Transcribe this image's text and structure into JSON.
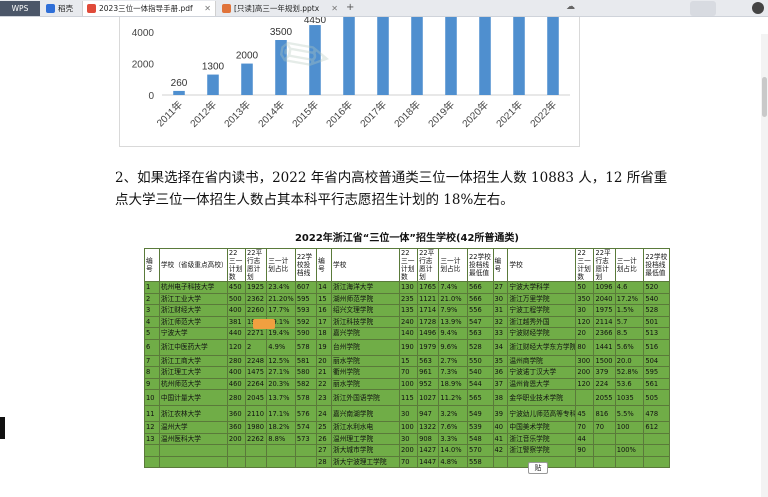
{
  "tabs": {
    "wps": "WPS",
    "home": "稻壳",
    "pdf": "2023三位一体指导手册.pdf",
    "pptx": "[只读]高三一年规划.pptx"
  },
  "chart_data": {
    "type": "bar",
    "categories": [
      "2011年",
      "2012年",
      "2013年",
      "2014年",
      "2015年",
      "2016年",
      "2017年",
      "2018年",
      "2019年",
      "2020年",
      "2021年",
      "2022年"
    ],
    "values": [
      260,
      1300,
      2000,
      3500,
      4450,
      null,
      null,
      null,
      null,
      null,
      null,
      null
    ],
    "data_labels": [
      "260",
      "1300",
      "2000",
      "3500",
      "4450"
    ],
    "yticks": [
      "0",
      "2000",
      "4000"
    ],
    "ylim": [
      0,
      5600
    ],
    "bar_color": "#4f8fcf"
  },
  "paragraph": "2、如果选择在省内读书，2022 年省内高校普通类三位一体招生人数 10883 人，12 所省重点大学三位一体招生人数占其本科平行志愿招生计划的 18%左右。",
  "table": {
    "title": "2022年浙江省“三位一体”招生学校(42所普通类)",
    "headers": [
      "编号",
      "学校（省级重点高校）",
      "22三一计划数",
      "22平行志愿计划",
      "三一计划占比",
      "22学校投档线",
      "编号",
      "学校",
      "22三一计划数",
      "22平行志愿计划",
      "三一计划占比",
      "22学校投档线最低值",
      "编号",
      "学校",
      "22三一计划数",
      "22平行志愿计划",
      "三一计划占比",
      "22学校投档线最低值"
    ],
    "rows": [
      [
        "1",
        "杭州电子科技大学",
        "450",
        "1925",
        "23.4%",
        "607",
        "14",
        "浙江海洋大学",
        "130",
        "1765",
        "7.4%",
        "566",
        "27",
        "宁波大学科学",
        "50",
        "1096",
        "4.6",
        "520"
      ],
      [
        "2",
        "浙江工业大学",
        "500",
        "2362",
        "21.20%",
        "595",
        "15",
        "湖州师范学院",
        "235",
        "1121",
        "21.0%",
        "566",
        "30",
        "浙江万里学院",
        "350",
        "2040",
        "17.2%",
        "540"
      ],
      [
        "3",
        "浙江财经大学",
        "400",
        "2260",
        "17.7%",
        "593",
        "16",
        "绍兴文理学院",
        "135",
        "1714",
        "7.9%",
        "556",
        "31",
        "宁波工程学院",
        "30",
        "1975",
        "1.5%",
        "528"
      ],
      [
        "4",
        "浙江师范大学",
        "381",
        "1997",
        "19.1%",
        "592",
        "17",
        "浙江科技学院",
        "240",
        "1728",
        "13.9%",
        "547",
        "32",
        "浙江越秀外国",
        "120",
        "2114",
        "5.7",
        "501"
      ],
      [
        "5",
        "宁波大学",
        "440",
        "2271",
        "19.4%",
        "590",
        "18",
        "嘉兴学院",
        "140",
        "1496",
        "9.4%",
        "563",
        "33",
        "宁波财经学院",
        "20",
        "2366",
        "8.5",
        "513"
      ],
      [
        "6",
        "浙江中医药大学",
        "120",
        "2",
        "4.9%",
        "578",
        "19",
        "台州学院",
        "190",
        "1979",
        "9.6%",
        "528",
        "34",
        "浙江财经大学东方学院",
        "80",
        "1441",
        "5.6%",
        "516"
      ],
      [
        "7",
        "浙江工商大学",
        "280",
        "2248",
        "12.5%",
        "581",
        "20",
        "丽水学院",
        "15",
        "563",
        "2.7%",
        "550",
        "35",
        "温州商学院",
        "300",
        "1500",
        "20.0",
        "504"
      ],
      [
        "8",
        "浙江理工大学",
        "400",
        "1475",
        "27.1%",
        "580",
        "21",
        "衢州学院",
        "70",
        "961",
        "7.3%",
        "540",
        "36",
        "宁波诺丁汉大学",
        "200",
        "379",
        "52.8%",
        "595"
      ],
      [
        "9",
        "杭州师范大学",
        "460",
        "2264",
        "20.3%",
        "582",
        "22",
        "丽水学院",
        "100",
        "952",
        "18.9%",
        "544",
        "37",
        "温州肯恩大学",
        "120",
        "224",
        "53.6",
        "561"
      ],
      [
        "10",
        "中国计量大学",
        "280",
        "2045",
        "13.7%",
        "578",
        "23",
        "浙江外国语学院",
        "115",
        "1027",
        "11.2%",
        "565",
        "38",
        "金华职业技术学院",
        "",
        "2055",
        "1035",
        "505"
      ],
      [
        "11",
        "浙江农林大学",
        "360",
        "2110",
        "17.1%",
        "576",
        "24",
        "嘉兴南湖学院",
        "30",
        "947",
        "3.2%",
        "549",
        "39",
        "宁波幼儿师范高等专科学校",
        "45",
        "816",
        "5.5%",
        "478"
      ],
      [
        "12",
        "温州大学",
        "360",
        "1980",
        "18.2%",
        "574",
        "25",
        "浙江水利水电",
        "100",
        "1322",
        "7.6%",
        "539",
        "40",
        "中国美术学院",
        "70",
        "70",
        "100",
        "612"
      ],
      [
        "13",
        "温州医科大学",
        "200",
        "2262",
        "8.8%",
        "573",
        "26",
        "温州理工学院",
        "30",
        "908",
        "3.3%",
        "548",
        "41",
        "浙江音乐学院",
        "44",
        "",
        "",
        ""
      ],
      [
        "",
        "",
        "",
        "",
        "",
        "",
        "27",
        "浙大城市学院",
        "200",
        "1427",
        "14.0%",
        "570",
        "42",
        "浙江警察学院",
        "90",
        "",
        "100%",
        ""
      ],
      [
        "",
        "",
        "",
        "",
        "",
        "",
        "28",
        "浙大宁波理工学院",
        "70",
        "1447",
        "4.8%",
        "558",
        "",
        "",
        "",
        "",
        "",
        ""
      ]
    ]
  },
  "paste_label": "贴"
}
